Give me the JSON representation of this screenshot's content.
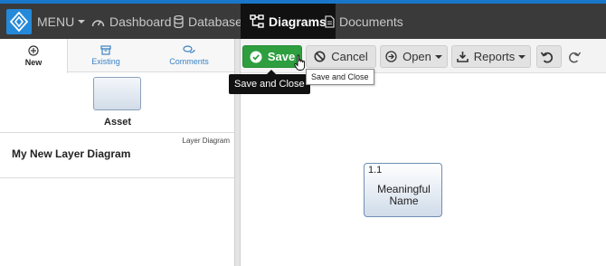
{
  "nav": {
    "menu_label": "MENU",
    "items": [
      {
        "label": "Dashboard",
        "icon": "gauge-icon"
      },
      {
        "label": "Database",
        "icon": "database-icon"
      },
      {
        "label": "Diagrams",
        "icon": "sitemap-icon",
        "active": true
      },
      {
        "label": "Documents",
        "icon": "document-icon"
      }
    ]
  },
  "left_panel": {
    "tabs": [
      {
        "label": "New",
        "icon": "plus-circle-icon",
        "active": true
      },
      {
        "label": "Existing",
        "icon": "archive-icon"
      },
      {
        "label": "Comments",
        "icon": "comments-icon"
      }
    ],
    "asset_label": "Asset",
    "diagram_type": "Layer Diagram",
    "diagram_name": "My New Layer Diagram"
  },
  "toolbar": {
    "save_label": "Save",
    "cancel_label": "Cancel",
    "open_label": "Open",
    "reports_label": "Reports"
  },
  "tooltips": {
    "dark": "Save and Close",
    "light": "Save and Close"
  },
  "canvas": {
    "node_number": "1.1",
    "node_line1": "Meaningful",
    "node_line2": "Name"
  },
  "colors": {
    "accent": "#1a76c8",
    "nav_bg": "#3a3a3a",
    "save_green": "#2e9e3f",
    "link_blue": "#3b82c4"
  }
}
